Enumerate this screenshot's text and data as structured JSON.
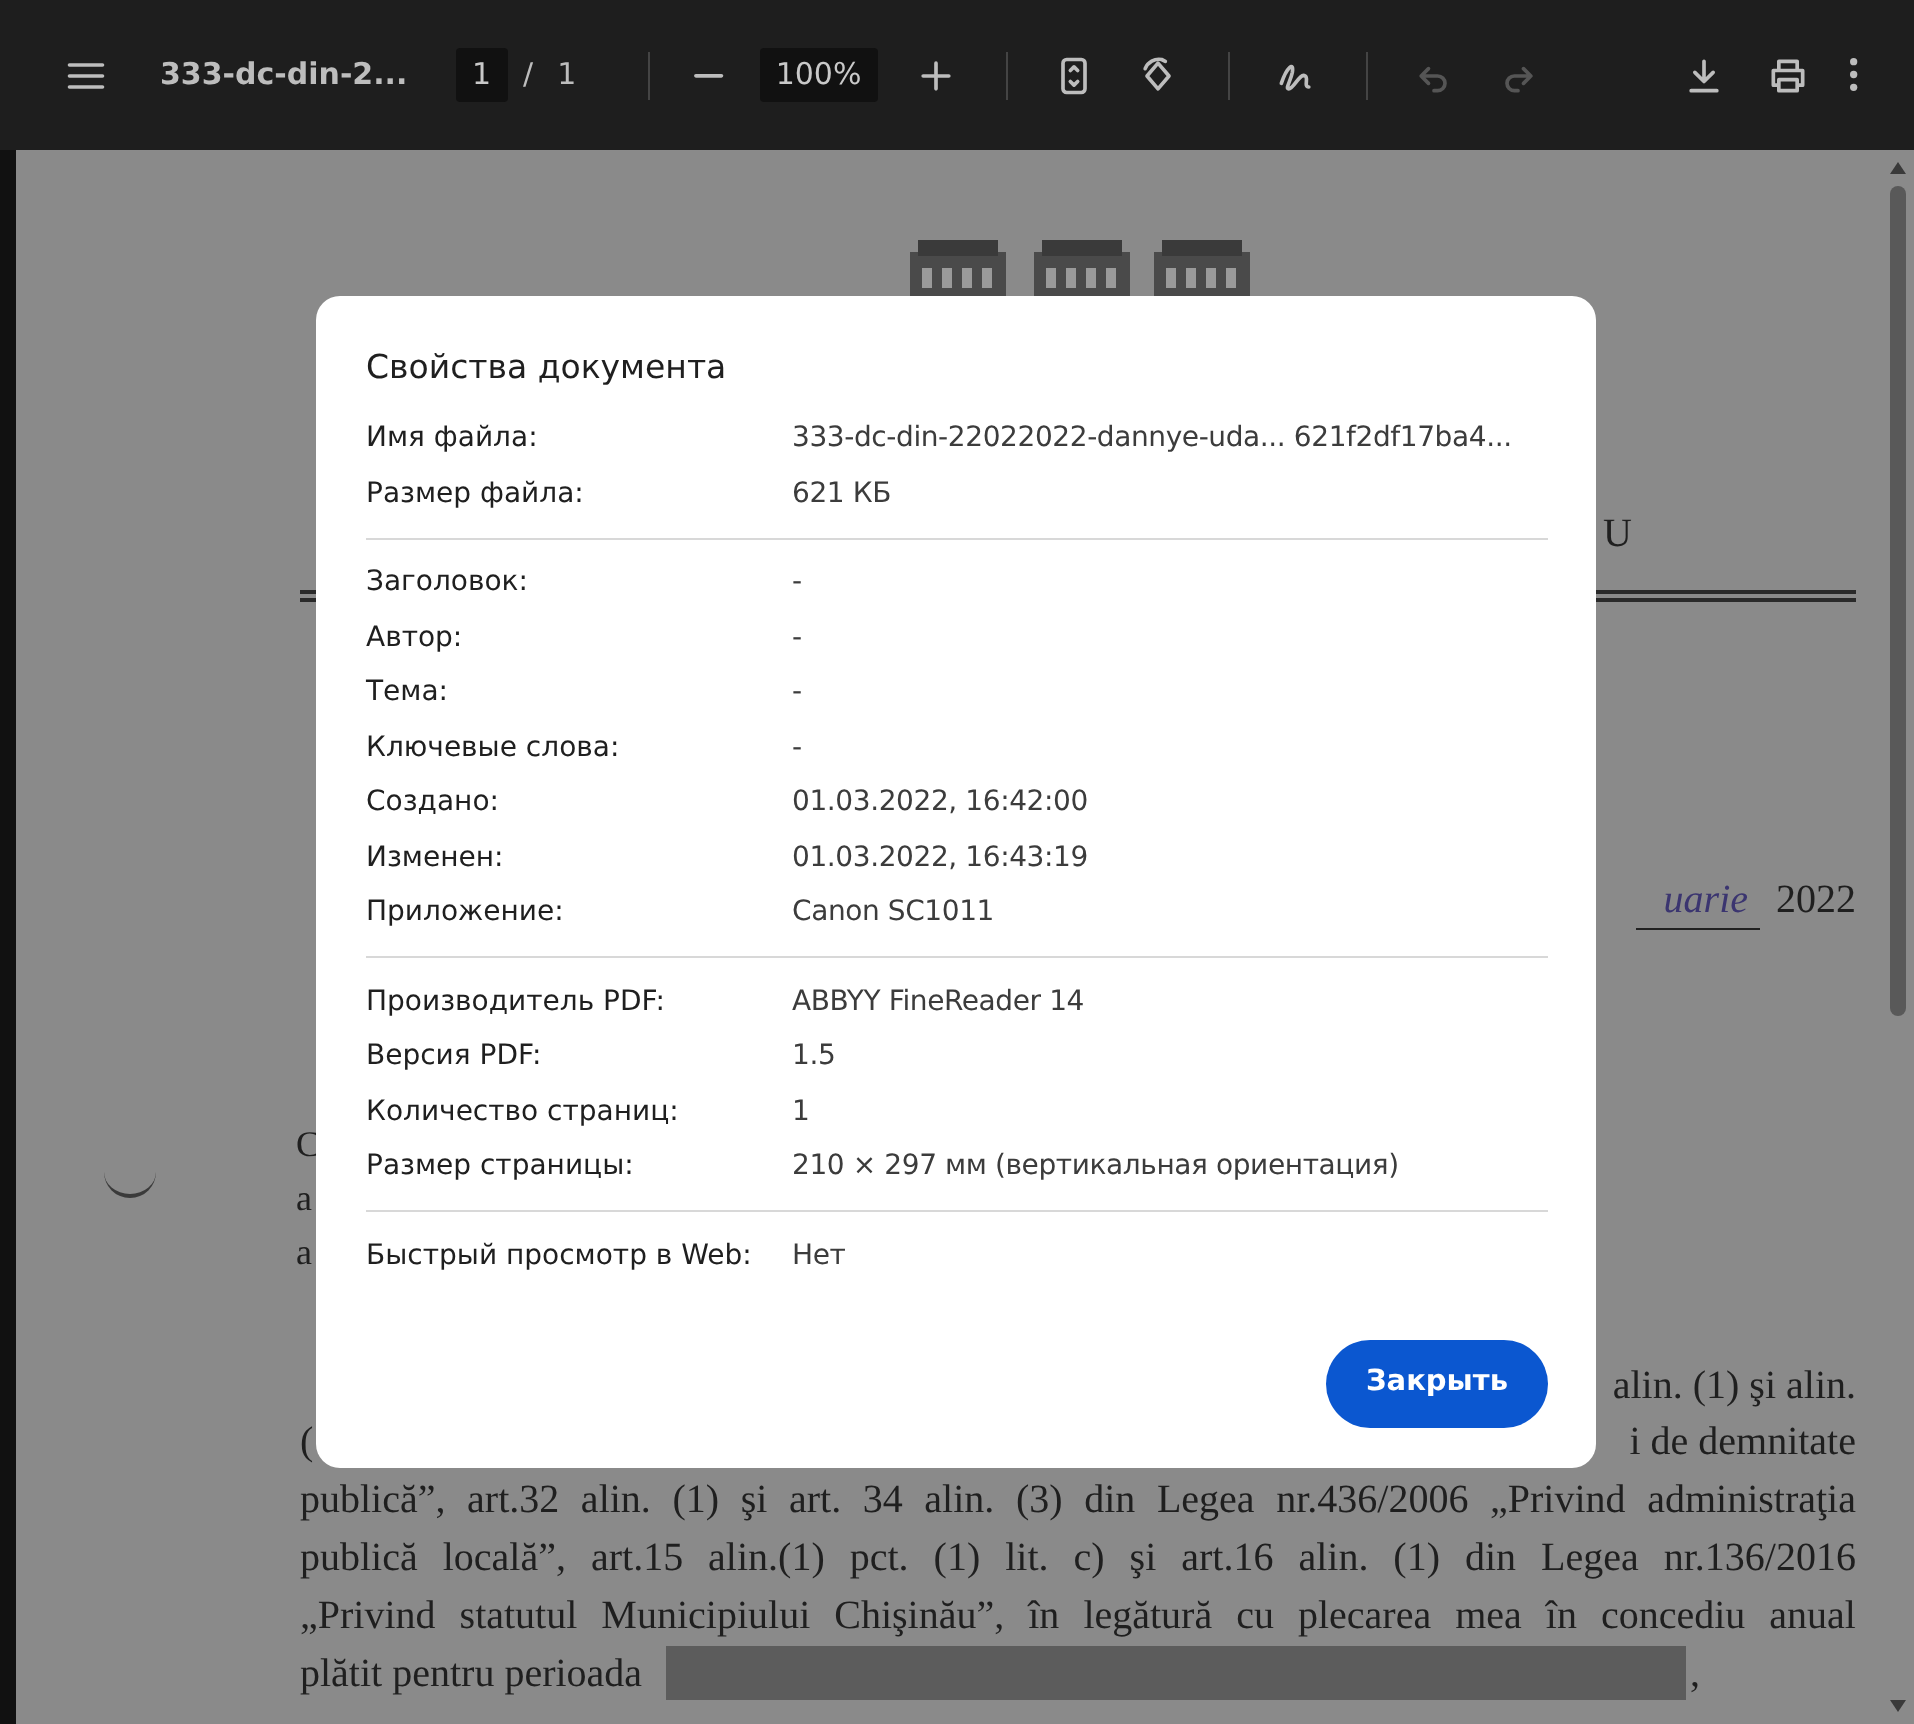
{
  "toolbar": {
    "title": "333-dc-din-2...",
    "page": "1",
    "page_separator": "/",
    "page_count": "1",
    "zoom": "100%",
    "tools": [
      {
        "kind": "zoom-out",
        "disabled": false
      },
      {
        "kind": "zoom-in",
        "disabled": false
      },
      {
        "kind": "fit",
        "disabled": false
      },
      {
        "kind": "rotate",
        "disabled": false
      },
      {
        "kind": "annotate",
        "disabled": false
      },
      {
        "kind": "undo",
        "disabled": true
      },
      {
        "kind": "redo",
        "disabled": true
      },
      {
        "kind": "download",
        "disabled": false
      },
      {
        "kind": "print",
        "disabled": false
      },
      {
        "kind": "more",
        "disabled": false
      }
    ]
  },
  "document": {
    "header_mark": "U",
    "date_handwritten": "uarie",
    "date_year": "2022",
    "left_fragments": [
      "C",
      "a",
      "a"
    ],
    "partial_lines": [
      {
        "right": "alin. (1) şi alin."
      },
      {
        "left": "(",
        "right": "i de demnitate"
      }
    ],
    "lines": [
      "publică”, art.32 alin. (1) şi art. 34 alin. (3) din Legea nr.436/2006 „Privind administraţia",
      "publică locală”, art.15 alin.(1) pct. (1) lit. c) şi art.16 alin. (1) din Legea nr.136/2016",
      "„Privind statutul Municipiului Chişinău”, în legătură cu plecarea mea în concediu anual"
    ],
    "last_line": "plătit pentru perioada",
    "last_line_end": ","
  },
  "dialog": {
    "title": "Свойства документа",
    "sections": [
      [
        {
          "label": "Имя файла:",
          "value": "333-dc-din-22022022-dannye-uda... 621f2df17ba4..."
        },
        {
          "label": "Размер файла:",
          "value": "621 КБ"
        }
      ],
      [
        {
          "label": "Заголовок:",
          "value": "-"
        },
        {
          "label": "Автор:",
          "value": "-"
        },
        {
          "label": "Тема:",
          "value": "-"
        },
        {
          "label": "Ключевые слова:",
          "value": "-"
        },
        {
          "label": "Создано:",
          "value": "01.03.2022, 16:42:00"
        },
        {
          "label": "Изменен:",
          "value": "01.03.2022, 16:43:19"
        },
        {
          "label": "Приложение:",
          "value": "Canon SC1011"
        }
      ],
      [
        {
          "label": "Производитель PDF:",
          "value": "ABBYY FineReader 14"
        },
        {
          "label": "Версия PDF:",
          "value": "1.5"
        },
        {
          "label": "Количество страниц:",
          "value": "1"
        },
        {
          "label": "Размер страницы:",
          "value": "210 × 297 мм (вертикальная ориентация)"
        }
      ],
      [
        {
          "label": "Быстрый просмотр в Web:",
          "value": "Нет"
        }
      ]
    ],
    "close_button": "Закрыть"
  }
}
